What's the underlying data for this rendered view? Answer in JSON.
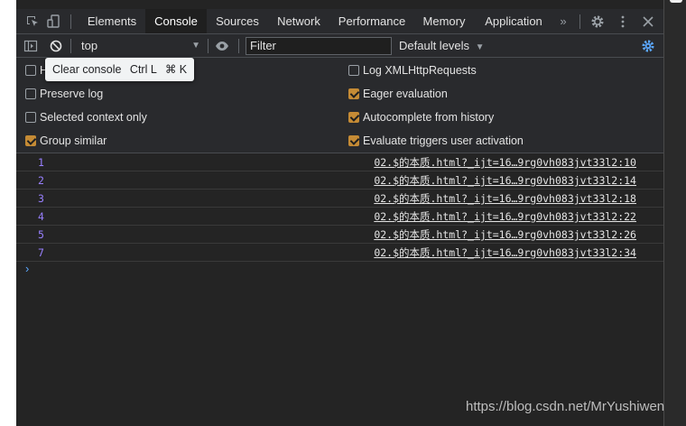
{
  "tabs": [
    {
      "label": "Elements"
    },
    {
      "label": "Console"
    },
    {
      "label": "Sources"
    },
    {
      "label": "Network"
    },
    {
      "label": "Performance"
    },
    {
      "label": "Memory"
    },
    {
      "label": "Application"
    }
  ],
  "tabs_more": "»",
  "toolbar": {
    "context": "top",
    "filter_placeholder": "Filter",
    "levels": "Default levels"
  },
  "tooltip": {
    "label": "Clear console",
    "shortcut1": "Ctrl L",
    "shortcut2": "⌘ K"
  },
  "settings": {
    "left": [
      {
        "label": "H",
        "checked": false
      },
      {
        "label": "Preserve log",
        "checked": false
      },
      {
        "label": "Selected context only",
        "checked": false
      },
      {
        "label": "Group similar",
        "checked": true
      }
    ],
    "right": [
      {
        "label": "Log XMLHttpRequests",
        "checked": false
      },
      {
        "label": "Eager evaluation",
        "checked": true
      },
      {
        "label": "Autocomplete from history",
        "checked": true
      },
      {
        "label": "Evaluate triggers user activation",
        "checked": true
      }
    ]
  },
  "log": [
    {
      "value": "1",
      "source": "02.$的本质.html?_ijt=16…9rg0vh083jvt33l2:10"
    },
    {
      "value": "2",
      "source": "02.$的本质.html?_ijt=16…9rg0vh083jvt33l2:14"
    },
    {
      "value": "3",
      "source": "02.$的本质.html?_ijt=16…9rg0vh083jvt33l2:18"
    },
    {
      "value": "4",
      "source": "02.$的本质.html?_ijt=16…9rg0vh083jvt33l2:22"
    },
    {
      "value": "5",
      "source": "02.$的本质.html?_ijt=16…9rg0vh083jvt33l2:26"
    },
    {
      "value": "7",
      "source": "02.$的本质.html?_ijt=16…9rg0vh083jvt33l2:34"
    }
  ],
  "prompt": "›",
  "watermark": "https://blog.csdn.net/MrYushiwen",
  "colors": {
    "accent_checkbox": "#c58b35",
    "number_value": "#9980ff",
    "settings_gear": "#5ba8ff"
  },
  "icons": [
    "inspect-icon",
    "device-toggle-icon",
    "more-tabs-icon",
    "settings-gear-icon",
    "kebab-menu-icon",
    "close-icon",
    "sidebar-toggle-icon",
    "clear-console-icon",
    "eye-icon",
    "console-settings-icon"
  ]
}
